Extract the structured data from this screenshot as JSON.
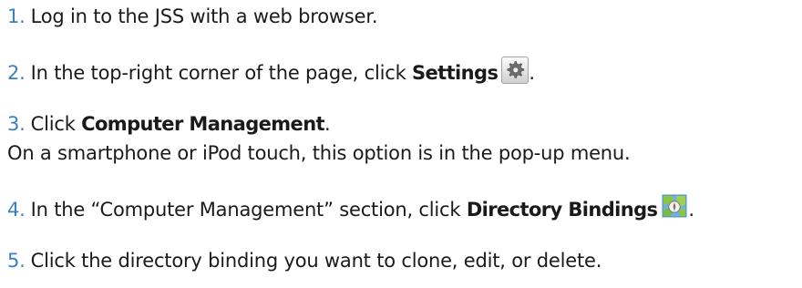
{
  "steps": [
    {
      "number": "1.",
      "text": "Log in to the JSS with a web browser."
    },
    {
      "number": "2.",
      "text_before": "In the top-right corner of the page, click ",
      "bold": "Settings",
      "icon": "gear-icon",
      "text_after": "."
    },
    {
      "number": "3.",
      "text_before": "Click ",
      "bold": "Computer Management",
      "text_after": ".",
      "note": "On a smartphone or iPod touch, this option is in the pop-up menu."
    },
    {
      "number": "4.",
      "text_before": "In the “Computer Management” section, click ",
      "bold": "Directory Bindings",
      "icon": "directory-bindings-map-icon",
      "text_after": "."
    },
    {
      "number": "5.",
      "text": "Click the directory binding you want to clone, edit, or delete."
    }
  ]
}
